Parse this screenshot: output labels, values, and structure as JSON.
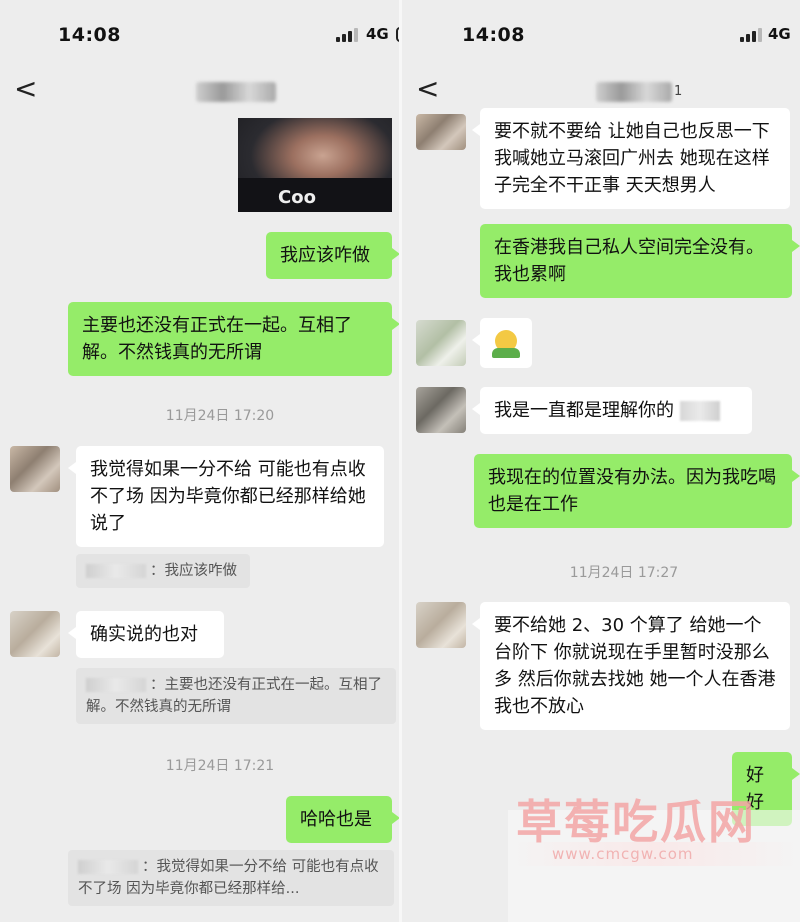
{
  "status": {
    "time": "14:08",
    "network": "4G"
  },
  "left": {
    "messages": {
      "sent_1": "我应该咋做",
      "sent_2": "主要也还没有正式在一起。互相了解。不然钱真的无所谓",
      "stamp_1": "11月24日 17:20",
      "recv_1": "我觉得如果一分不给 可能也有点收不了场 因为毕竟你都已经那样给她说了",
      "quote_1": "：我应该咋做",
      "recv_2": "确实说的也对",
      "quote_2": "：主要也还没有正式在一起。互相了解。不然钱真的无所谓",
      "stamp_2": "11月24日 17:21",
      "sent_3": "哈哈也是",
      "quote_3": "：我觉得如果一分不给 可能也有点收不了场 因为毕竟你都已经那样给..."
    },
    "photo_text": "Coo"
  },
  "right": {
    "title_suffix": "1",
    "messages": {
      "recv_1": "要不就不要给 让她自己也反思一下 我喊她立马滚回广州去 她现在这样子完全不干正事 天天想男人",
      "sent_1": "在香港我自己私人空间完全没有。我也累啊",
      "recv_2": "我是一直都是理解你的",
      "sent_2": "我现在的位置没有办法。因为我吃喝也是在工作",
      "stamp_1": "11月24日 17:27",
      "recv_3": "要不给她 2、30 个算了 给她一个台阶下 你就说现在手里暂时没那么多 然后你就去找她 她一个人在香港我也不放心",
      "sent_3": "好好"
    }
  },
  "watermark": {
    "text": "草莓吃瓜网",
    "url": "www.cmcgw.com"
  },
  "colors": {
    "sent_bubble": "#95ec69",
    "recv_bubble": "#ffffff",
    "background": "#ededed"
  }
}
